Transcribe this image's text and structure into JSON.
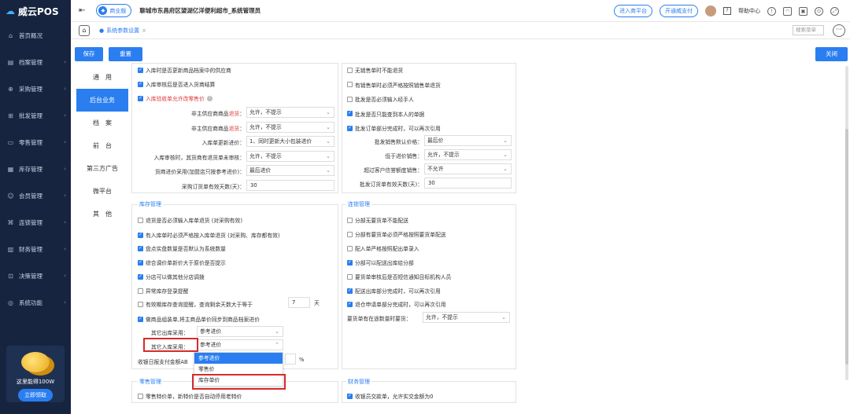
{
  "app": {
    "logo_text": "威云POS"
  },
  "sidebar": {
    "items": [
      {
        "label": "首页概况",
        "icon": "home-icon"
      },
      {
        "label": "档案管理",
        "icon": "archive-icon"
      },
      {
        "label": "采购管理",
        "icon": "purchase-icon"
      },
      {
        "label": "批发管理",
        "icon": "wholesale-icon"
      },
      {
        "label": "零售管理",
        "icon": "retail-icon"
      },
      {
        "label": "库存管理",
        "icon": "inventory-icon"
      },
      {
        "label": "会员管理",
        "icon": "member-icon"
      },
      {
        "label": "连锁管理",
        "icon": "chain-icon"
      },
      {
        "label": "财务管理",
        "icon": "finance-icon"
      },
      {
        "label": "决策管理",
        "icon": "decision-icon"
      },
      {
        "label": "系统功能",
        "icon": "system-icon"
      }
    ],
    "promo_text": "这里能得100W",
    "promo_button": "立即领取"
  },
  "header": {
    "biz_badge": "商业版",
    "shop_name": "聊城市东昌府区望湖亿洋便利超市_系统管理员",
    "btn_platform": "进入商平台",
    "btn_pay": "开通威支付",
    "help": "帮助中心"
  },
  "tabs": {
    "active_tab": "系统参数设置",
    "search_placeholder": "搜索菜单"
  },
  "actions": {
    "save": "保存",
    "reset": "重置",
    "close": "关闭"
  },
  "setnav": [
    "通　用",
    "后台业务",
    "档　案",
    "前　台",
    "第三方广告",
    "微平台",
    "其　他"
  ],
  "purchase_left": {
    "checks": [
      {
        "label": "入库时是否更新商品档案中的供应商",
        "checked": true
      },
      {
        "label": "入库审核后是否进入货商结算",
        "checked": true
      },
      {
        "label": "入库验收单允许改零售价",
        "checked": true
      }
    ],
    "fields": [
      {
        "label_pre": "非主供应商商品",
        "label_red": "退货",
        "label_post": "：",
        "value": "允许，不提示"
      },
      {
        "label_pre": "非主供应商商品",
        "label_red": "退货",
        "label_post": "：",
        "value": "允许，不提示"
      },
      {
        "label_pre": "入库单更新进价：",
        "label_red": "",
        "label_post": "",
        "value": "1、同时更新大小包装进价"
      },
      {
        "label_pre": "入库审核时，其货商有退货单未审核：",
        "label_red": "",
        "label_post": "",
        "value": "允许，不提示"
      },
      {
        "label_pre": "货商进价采用(加盟店只按参考进价)：",
        "label_red": "",
        "label_post": "",
        "value": "最后进价"
      },
      {
        "label_pre": "采购订货单有效天数(天)：",
        "label_red": "",
        "label_post": "",
        "value": "30"
      }
    ]
  },
  "purchase_right": {
    "checks": [
      {
        "label": "无销售单时不能退货",
        "checked": false
      },
      {
        "label": "有销售单时必须严格按照销售单退货",
        "checked": false
      },
      {
        "label": "批发是否必须输入经手人",
        "checked": false
      },
      {
        "label": "批发是否只能查到本人的单据",
        "checked": true
      },
      {
        "label": "批发订单部分完成时，可以再次引用",
        "checked": true
      }
    ],
    "fields": [
      {
        "label": "批发销售默认价格：",
        "value": "最后价"
      },
      {
        "label": "低于进价销售：",
        "value": "允许，不提示"
      },
      {
        "label": "超过客户信誉额度销售：",
        "value": "不允许"
      },
      {
        "label": "批发订货单有效天数(天)：",
        "value": "30"
      }
    ]
  },
  "inventory": {
    "title": "库存管理",
    "checks": [
      {
        "label": "退货是否必须输入库单退货 (对采购有效)",
        "checked": false
      },
      {
        "label": "有入库单时必须严格按入库单退货 (对采购、库存都有效)",
        "checked": true
      },
      {
        "label": "盘点实盘数量是否默认为系统数量",
        "checked": true
      },
      {
        "label": "综合调价单新价大于原价是否提示",
        "checked": true
      },
      {
        "label": "分店可以做其他分店调拨",
        "checked": true
      },
      {
        "label": "异常库存登录提醒",
        "checked": false
      },
      {
        "label": "有效期库存查询提醒，查询剩余天数大于等于",
        "checked": false
      },
      {
        "label": "做商品组装单,将主商品单价同步到商品档案进价",
        "checked": true
      }
    ],
    "expiry_days": "7",
    "expiry_unit": "天",
    "other_out_label": "其它出库采用：",
    "other_out_value": "参考进价",
    "other_in_label": "其它入库采用：",
    "other_in_value": "参考进价",
    "receipt_label": "收银日报支付金额AB",
    "percent": "%",
    "dropdown_options": [
      "参考进价",
      "零售价",
      "库存单价"
    ]
  },
  "chain": {
    "title": "连锁管理",
    "checks": [
      {
        "label": "分部无要货单不能配送",
        "checked": false
      },
      {
        "label": "分部有要货单必须严格按照要货单配送",
        "checked": false
      },
      {
        "label": "配入单严格按照配出单录入",
        "checked": false
      },
      {
        "label": "分部可以配送出库给分部",
        "checked": true
      },
      {
        "label": "要货单审核后是否短信通知目标机构人员",
        "checked": false
      },
      {
        "label": "配送出库部分完成时，可以再次引用",
        "checked": true
      },
      {
        "label": "退仓申请单部分完成时，可以再次引用",
        "checked": true
      }
    ],
    "field_label": "要货单有在途数量时要货：",
    "field_value": "允许，不提示"
  },
  "retail": {
    "title": "零售管理",
    "checks": [
      {
        "label": "零售特价单，新特价是否自动停用老特价",
        "checked": false
      }
    ]
  },
  "finance": {
    "title": "财务管理",
    "checks": [
      {
        "label": "收银员交款单，允许实交金额为0",
        "checked": true
      }
    ]
  },
  "colors": {
    "accent": "#2a7ef0",
    "sidebar_bg": "#16243f",
    "highlight_red": "#d62b2b"
  }
}
